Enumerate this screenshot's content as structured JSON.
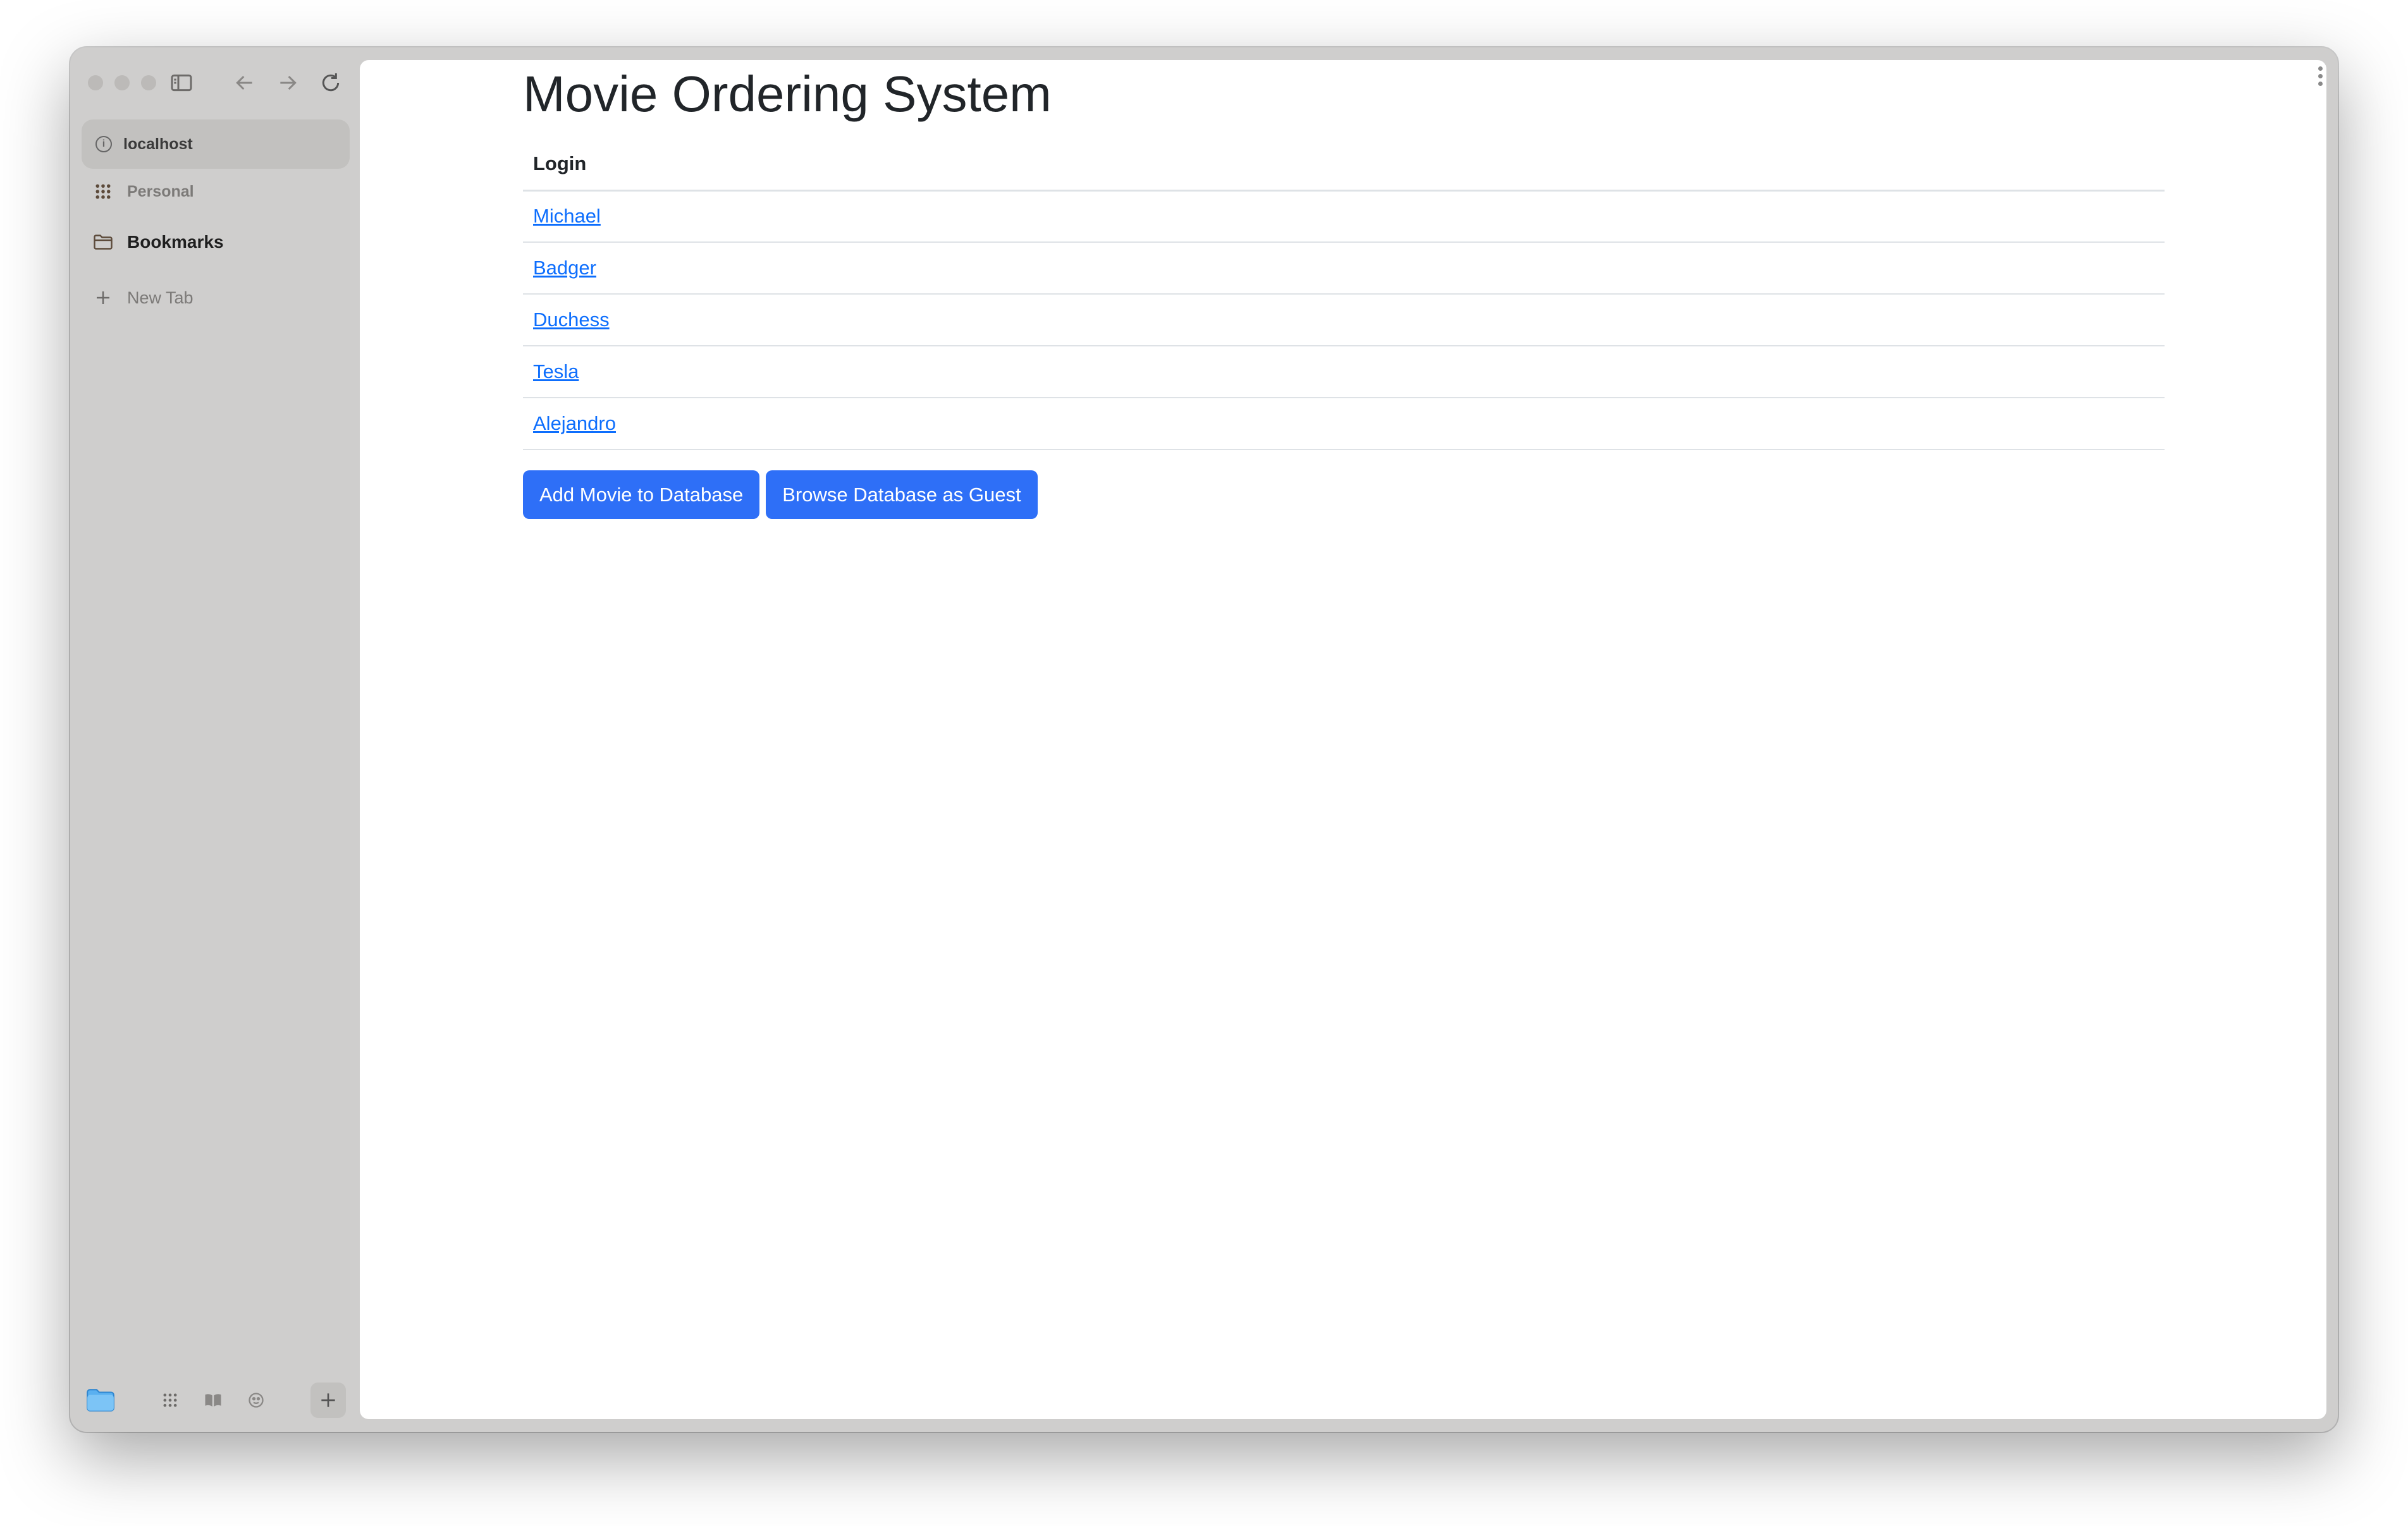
{
  "browser": {
    "url": "localhost",
    "sidebar": {
      "personal_label": "Personal",
      "bookmarks_label": "Bookmarks",
      "new_tab_label": "New Tab"
    }
  },
  "page": {
    "title": "Movie Ordering System",
    "table_header": "Login",
    "users": [
      "Michael",
      "Badger",
      "Duchess",
      "Tesla",
      "Alejandro"
    ],
    "buttons": {
      "add_movie": "Add Movie to Database",
      "browse_guest": "Browse Database as Guest"
    }
  },
  "colors": {
    "link": "#0d6efd",
    "button_bg": "#2e6ff7",
    "sidebar_bg": "#cfcecd"
  }
}
